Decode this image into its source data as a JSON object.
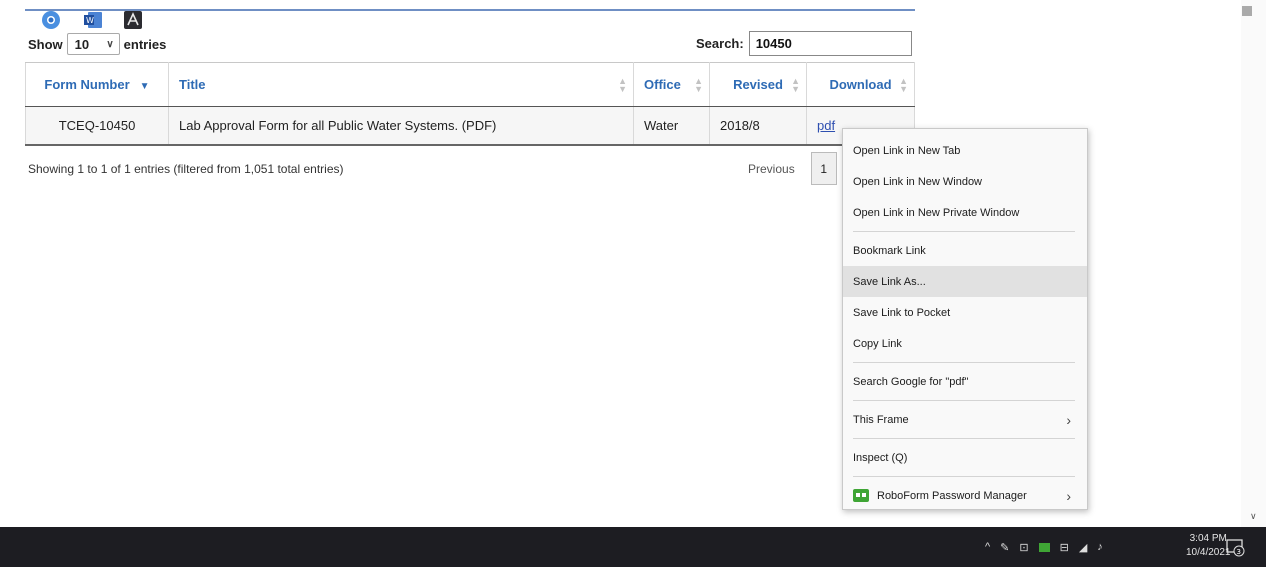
{
  "controls": {
    "show_label": "Show",
    "entries_value": "10",
    "entries_label": "entries",
    "search_label": "Search:",
    "search_value": "10450"
  },
  "table": {
    "columns": [
      "Form Number",
      "Title",
      "Office",
      "Revised",
      "Download"
    ],
    "rows": [
      {
        "form_number": "TCEQ-10450",
        "title": "Lab Approval Form for all Public Water Systems. (PDF)",
        "office": "Water",
        "revised": "2018/8",
        "download": "pdf"
      }
    ]
  },
  "footer": {
    "info": "Showing 1 to 1 of 1 entries (filtered from 1,051 total entries)",
    "previous": "Previous",
    "page": "1"
  },
  "context_menu": {
    "items": [
      {
        "label": "Open Link in New Tab"
      },
      {
        "label": "Open Link in New Window"
      },
      {
        "label": "Open Link in New Private Window"
      },
      {
        "label": "Bookmark Link"
      },
      {
        "label": "Save Link As..."
      },
      {
        "label": "Save Link to Pocket"
      },
      {
        "label": "Copy Link"
      },
      {
        "label": "Search Google for \"pdf\""
      },
      {
        "label": "This Frame"
      },
      {
        "label": "Inspect (Q)"
      },
      {
        "label": "RoboForm Password Manager"
      }
    ]
  },
  "taskbar": {
    "apps": [
      "chrome-icon",
      "word-icon",
      "acrobat-icon"
    ],
    "time": "3:04 PM",
    "date": "10/4/2021",
    "notification_count": "3"
  },
  "colors": {
    "link_blue": "#2e6bb5",
    "taskbar": "#1d1d22",
    "menu_highlight": "#e1e1e1"
  }
}
